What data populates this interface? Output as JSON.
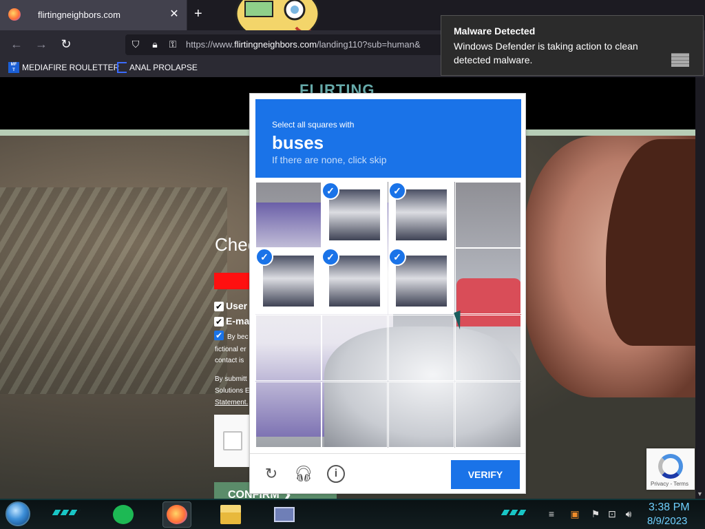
{
  "browser": {
    "tab_title": "flirtingneighbors.com",
    "tab_close": "✕",
    "new_tab": "+",
    "url_prefix": "https://www.",
    "url_host": "flirtingneighbors.com",
    "url_path": "/landing110?sub=human&",
    "bookmarks": [
      {
        "label": "MEDIAFIRE ROULETTER",
        "icon": "mediafire-icon",
        "icon_text": "MF\nT"
      },
      {
        "label": "ANAL PROLAPSE",
        "icon": "bookmark-icon"
      }
    ]
  },
  "page": {
    "logo": "FLIRTING",
    "form_title": "Chec",
    "checkboxes": [
      {
        "label": "User",
        "checked": true
      },
      {
        "label": "E-ma",
        "checked": true
      }
    ],
    "consent_prefix": "By bec",
    "consent_lines": [
      "fictional er",
      "contact is"
    ],
    "submit_lines": [
      "By submitt",
      "Solutions E"
    ],
    "statement_link": "Statement.",
    "confirm_label": "CONFIRM ❯"
  },
  "recaptcha": {
    "instruction": "Select all squares with",
    "target_word": "buses",
    "skip_hint": "If there are none, click skip",
    "selected_tiles": [
      1,
      2,
      4,
      5,
      6
    ],
    "verify_label": "VERIFY",
    "footer_icons": [
      "reload-icon",
      "audio-icon",
      "info-icon"
    ],
    "badge_text": "Privacy - Terms"
  },
  "notification": {
    "title": "Malware Detected",
    "body": "Windows Defender is taking action to clean detected malware."
  },
  "taskbar": {
    "apps": [
      "spotify-icon",
      "firefox-icon",
      "file-explorer-icon",
      "app-icon"
    ],
    "time": "3:38 PM",
    "date": "8/9/2023"
  },
  "colors": {
    "accent": "#1a73e8",
    "toast_bg": "#2b2b2b",
    "clock": "#6fd0ff"
  }
}
